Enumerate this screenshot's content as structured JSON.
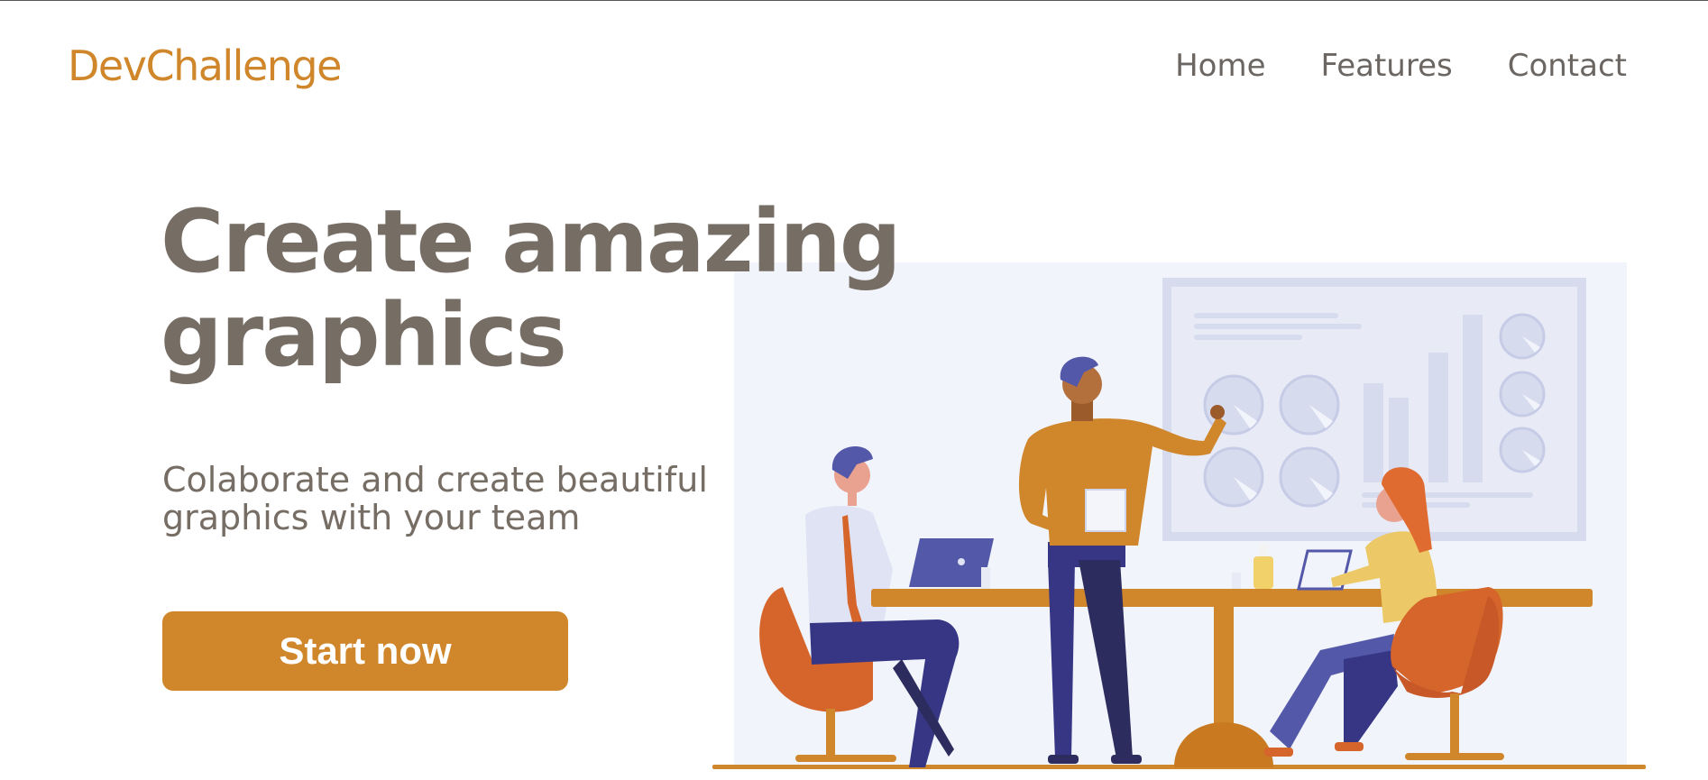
{
  "header": {
    "logo": "DevChallenge",
    "nav": [
      {
        "label": "Home"
      },
      {
        "label": "Features"
      },
      {
        "label": "Contact"
      }
    ]
  },
  "hero": {
    "title": "Create amazing graphics",
    "subtitle": "Colaborate and create beautiful graphics with your team",
    "cta_label": "Start now"
  },
  "colors": {
    "brand": "#d0862a",
    "text": "#766d65",
    "nav_text": "#6b6662",
    "illustration_bg": "#f1f4fb",
    "board": "#d6dbee",
    "navy": "#363685",
    "orange_chair": "#d6652b"
  },
  "illustration": {
    "name": "team-meeting-illustration"
  }
}
